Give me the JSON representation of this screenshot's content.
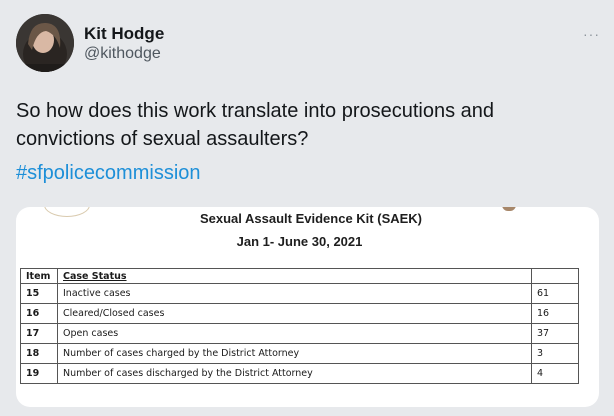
{
  "author": {
    "name": "Kit Hodge",
    "handle": "@kithodge"
  },
  "more_icon": "···",
  "tweet": {
    "text": "So how does this work translate into prosecutions and convictions of sexual assaulters?",
    "hashtag": "#sfpolicecommission"
  },
  "document": {
    "title": "Sexual Assault Evidence Kit (SAEK)",
    "date_range": "Jan 1- June 30, 2021",
    "table": {
      "headers": {
        "item": "Item",
        "status": "Case Status",
        "value": ""
      },
      "rows": [
        {
          "item": "15",
          "status": "Inactive cases",
          "value": "61"
        },
        {
          "item": "16",
          "status": "Cleared/Closed cases",
          "value": "16"
        },
        {
          "item": "17",
          "status": "Open cases",
          "value": "37"
        },
        {
          "item": "18",
          "status": "Number of cases charged by the District Attorney",
          "value": "3"
        },
        {
          "item": "19",
          "status": "Number of cases discharged by the District Attorney",
          "value": "4"
        }
      ]
    }
  },
  "colors": {
    "background": "#e7e9ec",
    "hashtag": "#1d8fd8",
    "text": "#14171a",
    "secondary_text": "#4f575f"
  }
}
